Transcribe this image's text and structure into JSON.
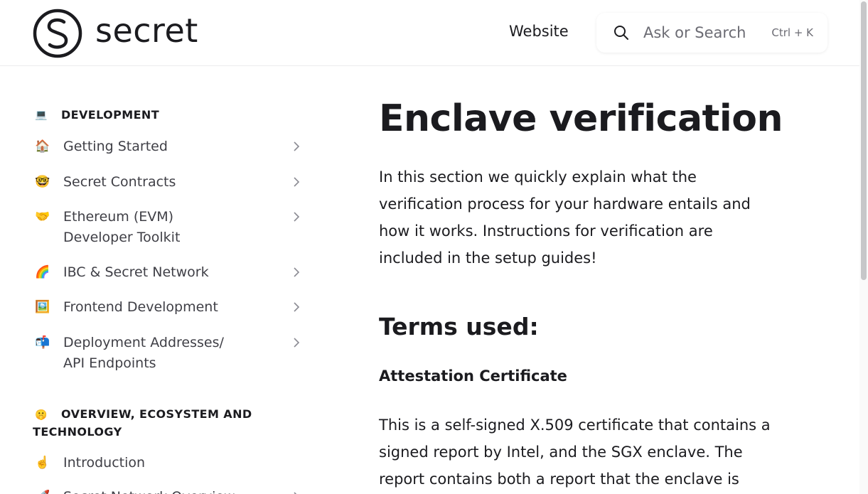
{
  "header": {
    "logo_text": "secret",
    "nav_link": "Website",
    "search_placeholder": "Ask or Search",
    "search_shortcut": "Ctrl + K"
  },
  "sidebar": {
    "sections": [
      {
        "emoji": "💻",
        "title": "DEVELOPMENT",
        "items": [
          {
            "emoji": "🏠",
            "label": "Getting Started"
          },
          {
            "emoji": "🤓",
            "label": "Secret Contracts"
          },
          {
            "emoji": "🤝",
            "label": "Ethereum (EVM) Developer Toolkit"
          },
          {
            "emoji": "🌈",
            "label": "IBC & Secret Network"
          },
          {
            "emoji": "🖼️",
            "label": "Frontend Development"
          },
          {
            "emoji": "📬",
            "label": "Deployment Addresses/ API Endpoints"
          }
        ]
      },
      {
        "emoji": "🤫",
        "title": "OVERVIEW, ECOSYSTEM AND TECHNOLOGY",
        "items": [
          {
            "emoji": "☝️",
            "label": "Introduction"
          },
          {
            "emoji": "🚀",
            "label": "Secret Network Overview"
          }
        ]
      }
    ]
  },
  "main": {
    "title": "Enclave verification",
    "lead": "In this section we quickly explain what the verification process for your hardware entails and how it works. Instructions for verification are included in the setup guides!",
    "h2": "Terms used:",
    "h3": "Attestation Certificate",
    "para": "This is a self-signed X.509 certificate that contains a signed report by Intel, and the SGX enclave. The report contains both a report that the enclave is"
  }
}
